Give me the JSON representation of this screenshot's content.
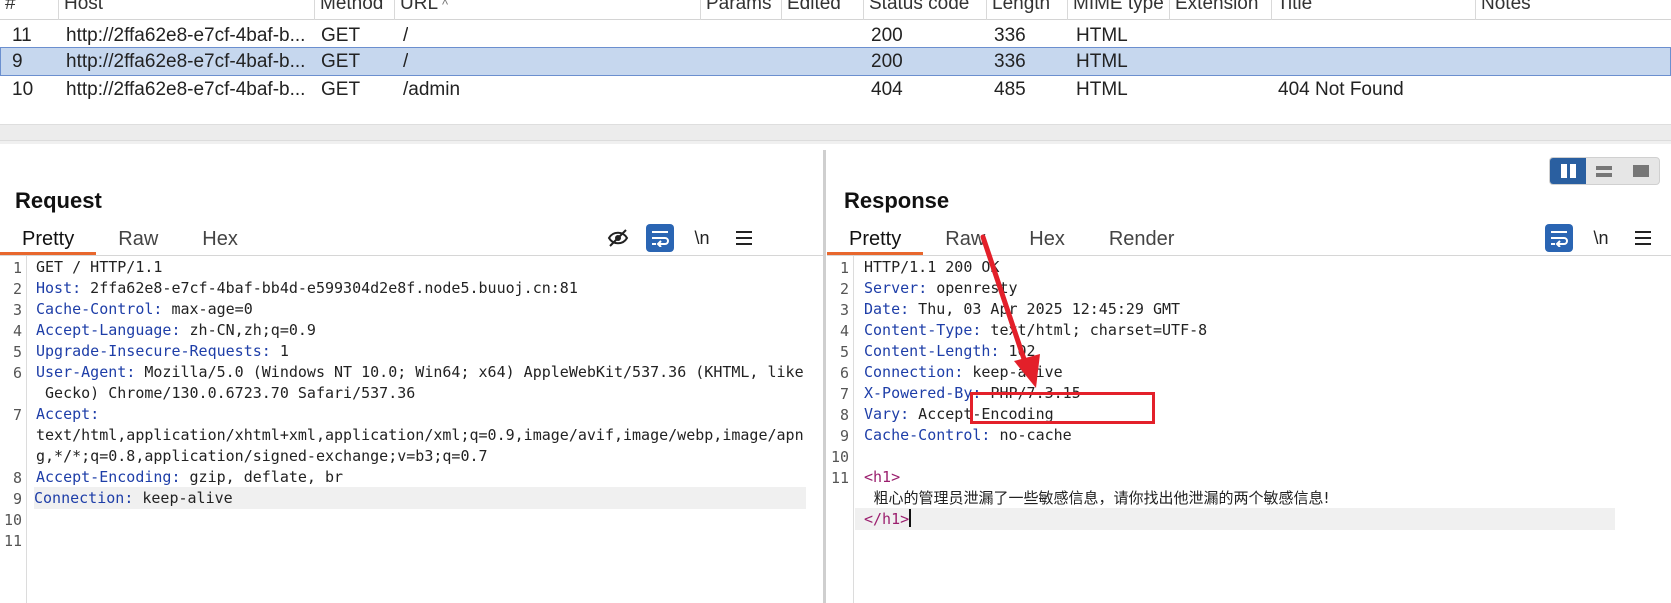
{
  "history": {
    "columns": [
      "#",
      "Host",
      "Method",
      "URL",
      "Params",
      "Edited",
      "Status code",
      "Length",
      "MIME type",
      "Extension",
      "Title",
      "Notes"
    ],
    "sort_indicator": "^",
    "rows": [
      {
        "id": "11",
        "host": "http://2ffa62e8-e7cf-4baf-b...",
        "method": "GET",
        "url": "/",
        "status": "200",
        "length": "336",
        "mime": "HTML",
        "title": ""
      },
      {
        "id": "9",
        "host": "http://2ffa62e8-e7cf-4baf-b...",
        "method": "GET",
        "url": "/",
        "status": "200",
        "length": "336",
        "mime": "HTML",
        "title": "",
        "selected": true
      },
      {
        "id": "10",
        "host": "http://2ffa62e8-e7cf-4baf-b...",
        "method": "GET",
        "url": "/admin",
        "status": "404",
        "length": "485",
        "mime": "HTML",
        "title": "404 Not Found"
      }
    ]
  },
  "request": {
    "title": "Request",
    "tabs": [
      "Pretty",
      "Raw",
      "Hex"
    ],
    "active_tab": "Pretty",
    "tools": {
      "hide": "eye-slash-icon",
      "wrap": "word-wrap-icon",
      "newline": "\\n",
      "menu": "hamburger-menu-icon"
    },
    "line_numbers": [
      "1",
      "2",
      "3",
      "4",
      "5",
      "6",
      "7",
      "8",
      "9",
      "10",
      "11"
    ],
    "lines": [
      {
        "plain": "GET / HTTP/1.1"
      },
      {
        "name": "Host",
        "value": " 2ffa62e8-e7cf-4baf-bb4d-e599304d2e8f.node5.buuoj.cn:81"
      },
      {
        "name": "Cache-Control",
        "value": " max-age=0"
      },
      {
        "name": "Accept-Language",
        "value": " zh-CN,zh;q=0.9"
      },
      {
        "name": "Upgrade-Insecure-Requests",
        "value": " 1"
      },
      {
        "name": "User-Agent",
        "value": " Mozilla/5.0 (Windows NT 10.0; Win64; x64) AppleWebKit/537.36 (KHTML, like",
        "cont": " Gecko) Chrome/130.0.6723.70 Safari/537.36"
      },
      {
        "name": "Accept",
        "value": "",
        "cont": "text/html,application/xhtml+xml,application/xml;q=0.9,image/avif,image/webp,image/apn",
        "cont2": "g,*/*;q=0.8,application/signed-exchange;v=b3;q=0.7"
      },
      {
        "name": "Accept-Encoding",
        "value": " gzip, deflate, br"
      },
      {
        "name": "Connection",
        "value": " keep-alive"
      }
    ]
  },
  "response": {
    "title": "Response",
    "tabs": [
      "Pretty",
      "Raw",
      "Hex",
      "Render"
    ],
    "active_tab": "Pretty",
    "tools": {
      "wrap": "word-wrap-icon",
      "newline": "\\n",
      "menu": "hamburger-menu-icon"
    },
    "line_numbers": [
      "1",
      "2",
      "3",
      "4",
      "5",
      "6",
      "7",
      "8",
      "9",
      "10",
      "11"
    ],
    "lines": [
      {
        "plain": "HTTP/1.1 200 OK"
      },
      {
        "name": "Server",
        "value": " openresty"
      },
      {
        "name": "Date",
        "value": " Thu, 03 Apr 2025 12:45:29 GMT"
      },
      {
        "name": "Content-Type",
        "value": " text/html; charset=UTF-8"
      },
      {
        "name": "Content-Length",
        "value": " 102"
      },
      {
        "name": "Connection",
        "value": " keep-alive"
      },
      {
        "name": "X-Powered-By",
        "value": " PHP/7.3.15"
      },
      {
        "name": "Vary",
        "value": " Accept-Encoding"
      },
      {
        "name": "Cache-Control",
        "value": " no-cache"
      }
    ],
    "body": {
      "open_tag": "<h1>",
      "text": "  粗心的管理员泄漏了一些敏感信息，请你找出他泄漏的两个敏感信息!",
      "close_tag": "</h1>"
    }
  },
  "layout_toggle": {
    "options": [
      "split-columns-icon",
      "split-rows-icon",
      "tabs-icon"
    ],
    "active": "split-columns-icon"
  },
  "colors": {
    "selected_row": "#c6d7ee",
    "accent_tab": "#e8672d",
    "header_name": "#1e3ea8",
    "annotation": "#e3202a",
    "toggle_active": "#2a5fa0"
  }
}
